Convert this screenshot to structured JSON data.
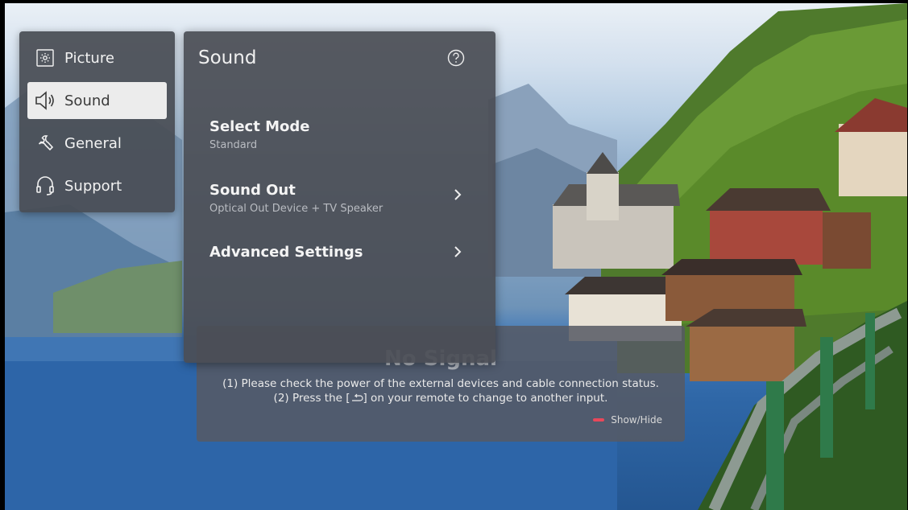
{
  "categories": [
    {
      "label": "Picture",
      "icon": "picture-icon",
      "selected": false
    },
    {
      "label": "Sound",
      "icon": "speaker-icon",
      "selected": true
    },
    {
      "label": "General",
      "icon": "wrench-icon",
      "selected": false
    },
    {
      "label": "Support",
      "icon": "headset-icon",
      "selected": false
    }
  ],
  "sound_panel": {
    "title": "Sound",
    "help_icon": "help-icon",
    "items": [
      {
        "label": "Select Mode",
        "value": "Standard",
        "has_submenu": false
      },
      {
        "label": "Sound Out",
        "value": "Optical Out Device + TV Speaker",
        "has_submenu": true
      },
      {
        "label": "Advanced Settings",
        "value": "",
        "has_submenu": true
      }
    ]
  },
  "no_signal": {
    "title": "No Signal",
    "line1": "(1) Please check the power of the external devices and cable connection status.",
    "line2_prefix": "(2) Press the [",
    "line2_suffix": "] on your remote to change to another input.",
    "input_icon": "input-source-icon",
    "show_hide_label": "Show/Hide",
    "show_hide_key_color": "#e8485a"
  }
}
